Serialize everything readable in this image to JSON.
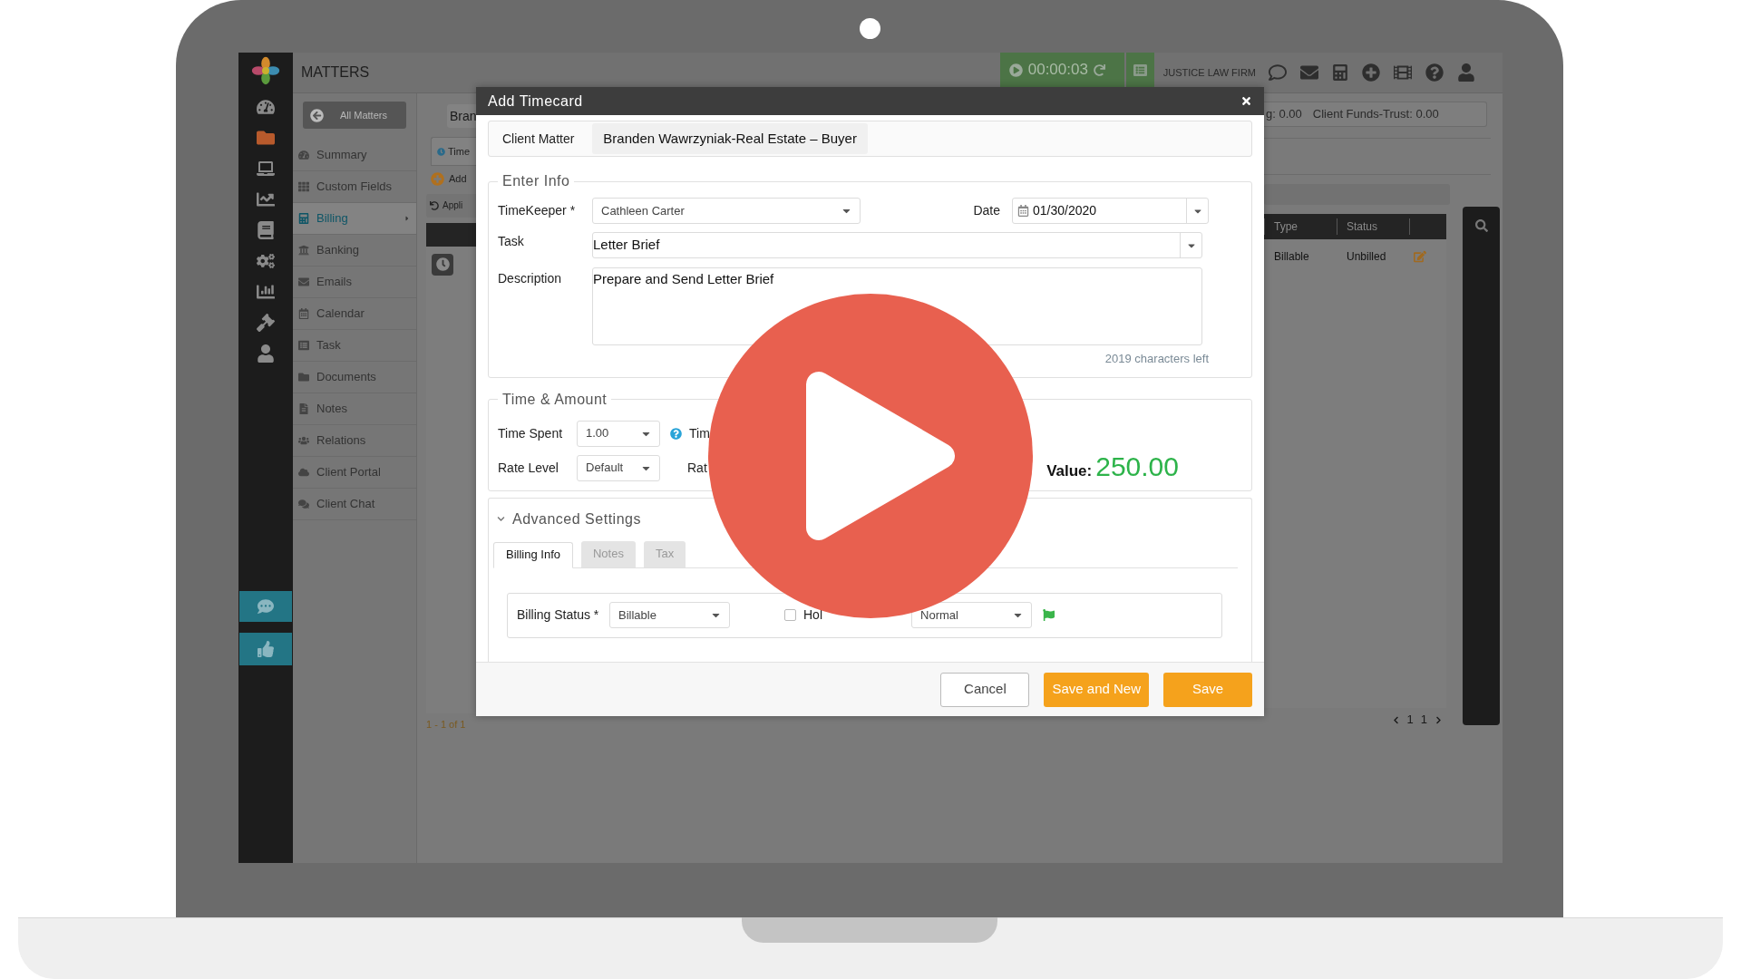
{
  "app": {
    "title": "MATTERS",
    "timer": "00:00:03",
    "firm": "JUSTICE LAW FIRM"
  },
  "rail": [
    {
      "selected": false
    },
    {
      "selected": true
    },
    {
      "selected": false
    },
    {
      "selected": false
    },
    {
      "selected": false
    },
    {
      "selected": false
    },
    {
      "selected": false
    },
    {
      "selected": false
    },
    {
      "selected": false
    }
  ],
  "back_button": "All Matters",
  "menu": [
    {
      "label": "Summary",
      "selected": false,
      "submenu": false
    },
    {
      "label": "Custom Fields",
      "selected": false,
      "submenu": false
    },
    {
      "label": "Billing",
      "selected": true,
      "submenu": true
    },
    {
      "label": "Banking",
      "selected": false,
      "submenu": false
    },
    {
      "label": "Emails",
      "selected": false,
      "submenu": false
    },
    {
      "label": "Calendar",
      "selected": false,
      "submenu": false
    },
    {
      "label": "Task",
      "selected": false,
      "submenu": false
    },
    {
      "label": "Documents",
      "selected": false,
      "submenu": false
    },
    {
      "label": "Notes",
      "selected": false,
      "submenu": false
    },
    {
      "label": "Relations",
      "selected": false,
      "submenu": false
    },
    {
      "label": "Client Portal",
      "selected": false,
      "submenu": false
    },
    {
      "label": "Client Chat",
      "selected": false,
      "submenu": false
    }
  ],
  "matter_tab": "Bran",
  "sub_tab": "Time",
  "add_link": "Add",
  "apply_link": "Appli",
  "record_count": "1 - 1 of 1",
  "summary": {
    "balance": "g: 0.00",
    "trust": "Client Funds-Trust: 0.00"
  },
  "table": {
    "columns": [
      "Type",
      "Status"
    ],
    "rows": [
      {
        "cells": [
          "Billable",
          "Unbilled"
        ]
      }
    ]
  },
  "pages": [
    "1",
    "1"
  ],
  "dialog": {
    "title": "Add Timecard",
    "client_matter": {
      "label": "Client Matter",
      "value": "Branden Wawrzyniak-Real Estate – Buyer"
    },
    "enter_info": {
      "legend": "Enter Info",
      "timekeeper": {
        "label": "TimeKeeper *",
        "value": "Cathleen Carter"
      },
      "date": {
        "label": "Date",
        "value": "01/30/2020"
      },
      "task": {
        "label": "Task",
        "value": "Letter Brief"
      },
      "description": {
        "label": "Description",
        "value": "Prepare and Send Letter Brief"
      },
      "chars_left": "2019 characters left"
    },
    "time_amount": {
      "legend": "Time & Amount",
      "time_spent": {
        "label": "Time Spent",
        "value": "1.00"
      },
      "time_fragment": "Tim",
      "rate_level": {
        "label": "Rate Level",
        "value": "Default"
      },
      "rate_fragment": "Rat",
      "value_label": "Value:",
      "value": "250.00"
    },
    "advanced": {
      "title": "Advanced Settings",
      "expanded": true,
      "tabs": [
        {
          "label": "Billing Info",
          "selected": true
        },
        {
          "label": "Notes",
          "selected": false
        },
        {
          "label": "Tax",
          "selected": false
        }
      ],
      "billing_status": {
        "label": "Billing Status *",
        "value": "Billable"
      },
      "hold": {
        "label": "Hol",
        "checked": false
      },
      "priority": {
        "value": "Normal"
      }
    },
    "buttons": [
      {
        "label": "Cancel",
        "kind": "secondary"
      },
      {
        "label": "Save and New",
        "kind": "primary"
      },
      {
        "label": "Save",
        "kind": "primary"
      }
    ]
  }
}
